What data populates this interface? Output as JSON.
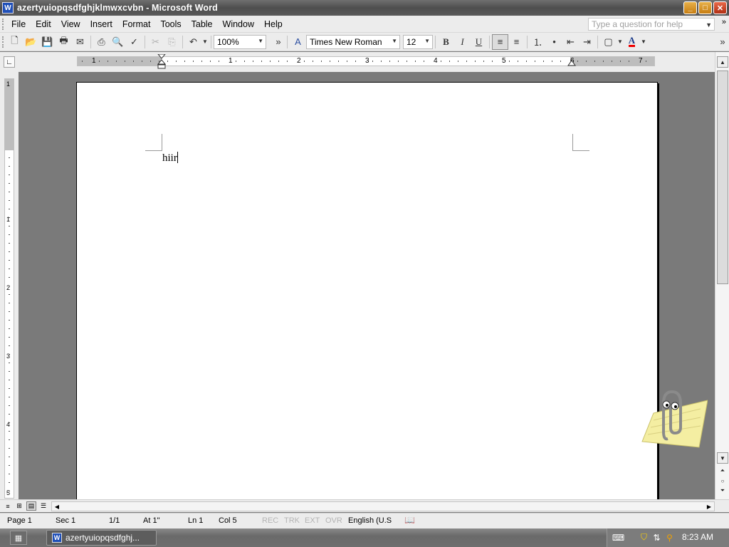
{
  "window": {
    "title": "azertyuiopqsdfghjklmwxcvbn - Microsoft Word",
    "app_icon": "W"
  },
  "menu": {
    "items": [
      "File",
      "Edit",
      "View",
      "Insert",
      "Format",
      "Tools",
      "Table",
      "Window",
      "Help"
    ],
    "help_placeholder": "Type a question for help"
  },
  "toolbar": {
    "icons": [
      "new-icon",
      "open-icon",
      "save-icon",
      "permission-icon",
      "email-icon",
      "print-icon",
      "print-preview-icon",
      "spelling-icon",
      "cut-icon",
      "copy-icon",
      "paste-icon",
      "undo-icon"
    ],
    "zoom": "100%",
    "font": "Times New Roman",
    "size": "12",
    "bold": "B",
    "italic": "I",
    "underline": "U",
    "font_color_letter": "A",
    "font_color": "#e00000"
  },
  "ruler": {
    "numbers": [
      "1",
      "1",
      "2",
      "3",
      "4",
      "5",
      "6",
      "7"
    ],
    "vertical_numbers": [
      "1",
      "1",
      "2",
      "3",
      "4",
      "5"
    ]
  },
  "document": {
    "text": "hiir"
  },
  "status": {
    "page": "Page 1",
    "sec": "Sec 1",
    "pages": "1/1",
    "at": "At 1\"",
    "ln": "Ln 1",
    "col": "Col 5",
    "rec": "REC",
    "trk": "TRK",
    "ext": "EXT",
    "ovr": "OVR",
    "language": "English (U.S"
  },
  "taskbar": {
    "task_label": "azertyuiopqsdfghj...",
    "clock": "8:23 AM"
  }
}
